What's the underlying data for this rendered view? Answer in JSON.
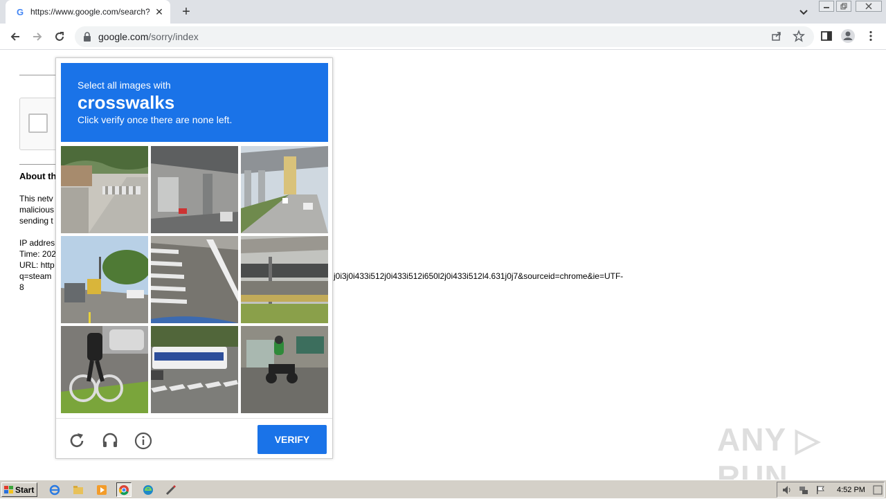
{
  "browser": {
    "tab_title": "https://www.google.com/search?q=",
    "new_tab_symbol": "+",
    "close_symbol": "✕",
    "url_host": "google.com",
    "url_path": "/sorry/index"
  },
  "page": {
    "about_heading": "About th",
    "para1": [
      "This netv",
      "malicious",
      "sending t"
    ],
    "para2": [
      "IP addres",
      "Time: 202",
      "URL: http",
      "q=steam"
    ],
    "url_tail": "j0i3j0i433i512j0i433i512i650l2j0i433i512l4.631j0j7&sourceid=chrome&ie=UTF-",
    "url_tail2": "8"
  },
  "captcha": {
    "line1": "Select all images with",
    "target": "crosswalks",
    "line3": "Click verify once there are none left.",
    "verify_label": "VERIFY",
    "accent": "#1a73e8"
  },
  "watermark": "ANY RUN",
  "taskbar": {
    "start_label": "Start",
    "clock": "4:52 PM"
  }
}
